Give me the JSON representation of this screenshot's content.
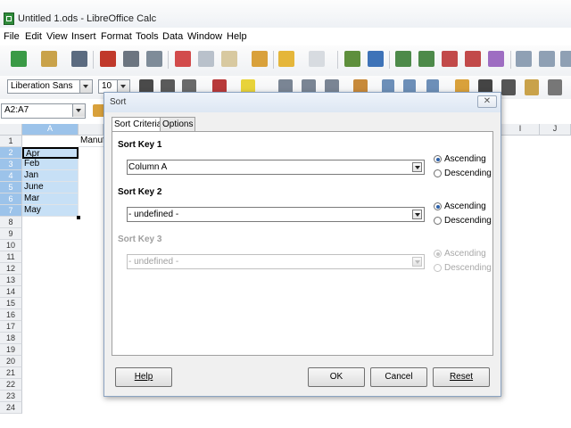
{
  "window": {
    "title": "Untitled 1.ods - LibreOffice Calc"
  },
  "menu": [
    "File",
    "Edit",
    "View",
    "Insert",
    "Format",
    "Tools",
    "Data",
    "Window",
    "Help"
  ],
  "formatting": {
    "font_name": "Liberation Sans",
    "font_size": "10"
  },
  "name_box": {
    "value": "A2:A7"
  },
  "sheet": {
    "columns": {
      "a": "A",
      "i": "I",
      "j": "J"
    },
    "rows": [
      "1",
      "2",
      "3",
      "4",
      "5",
      "6",
      "7",
      "8",
      "9",
      "10",
      "11",
      "12",
      "13",
      "14",
      "15",
      "16",
      "17",
      "18",
      "19",
      "20",
      "21",
      "22",
      "23",
      "24"
    ],
    "cells": {
      "b1": "Manuf",
      "a2": "Apr",
      "a3": "Feb",
      "a4": "Jan",
      "a5": "June",
      "a6": "Mar",
      "a7": "May"
    }
  },
  "dialog": {
    "title": "Sort",
    "close_glyph": "✕",
    "tabs": {
      "criteria": "Sort Criteria",
      "options": "Options"
    },
    "keys": [
      {
        "label": "Sort Key 1",
        "value": "Column A",
        "ascending": "Ascending",
        "descending": "Descending",
        "selected": "ascending",
        "enabled": true
      },
      {
        "label": "Sort Key 2",
        "value": "- undefined -",
        "ascending": "Ascending",
        "descending": "Descending",
        "selected": "ascending",
        "enabled": true
      },
      {
        "label": "Sort Key 3",
        "value": "- undefined -",
        "ascending": "Ascending",
        "descending": "Descending",
        "selected": "ascending",
        "enabled": false
      }
    ],
    "buttons": {
      "help": "Help",
      "ok": "OK",
      "cancel": "Cancel",
      "reset": "Reset"
    }
  },
  "colors": {
    "accent": "#2b5fa8",
    "selection": "#c7e0f6",
    "calc_green": "#2e8b3a"
  }
}
